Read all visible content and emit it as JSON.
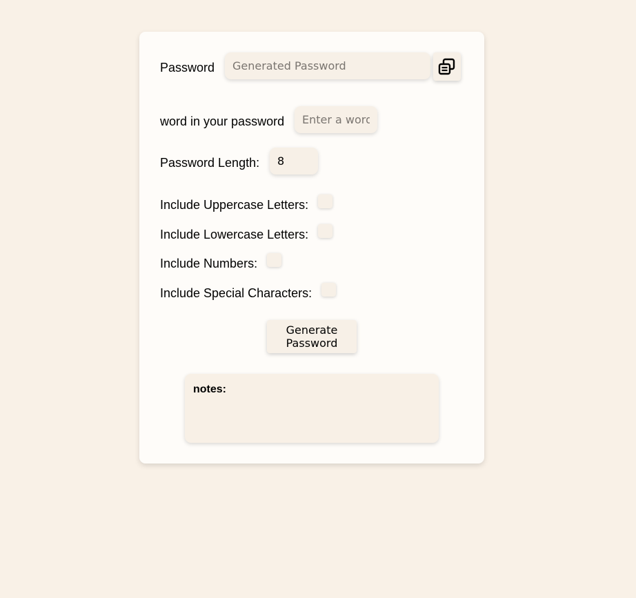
{
  "generator": {
    "password_label": "Password",
    "password_placeholder": "Generated Password",
    "copy_icon": "copy-icon",
    "word_label": "word in your password",
    "word_placeholder": "Enter a word",
    "length_label": "Password Length:",
    "length_value": "8",
    "options": [
      {
        "label": "Include Uppercase Letters:",
        "checked": false
      },
      {
        "label": "Include Lowercase Letters:",
        "checked": false
      },
      {
        "label": "Include Numbers:",
        "checked": false
      },
      {
        "label": "Include Special Characters:",
        "checked": false
      }
    ],
    "generate_label": "Generate Password"
  },
  "notes": {
    "title": "notes:"
  },
  "colors": {
    "page_background": "#f9f1e7",
    "card_background": "#fefcf9",
    "control_background": "#f7f0e7"
  }
}
